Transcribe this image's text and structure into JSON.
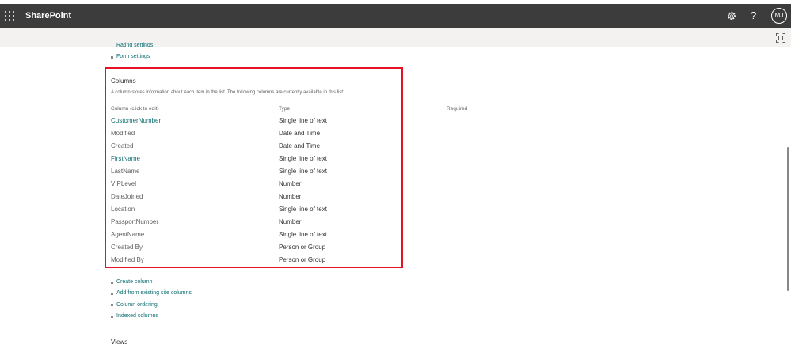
{
  "header": {
    "app_name": "SharePoint",
    "help_label": "?",
    "avatar_initials": "MJ"
  },
  "above": {
    "partial_link": "Rating settings",
    "form_settings": "Form settings"
  },
  "columns_section": {
    "title": "Columns",
    "description": "A column stores information about each item in the list. The following columns are currently available in this list:",
    "headers": {
      "name": "Column (click to edit)",
      "type": "Type",
      "required": "Required"
    },
    "rows": [
      {
        "name": "CustomerNumber",
        "type": "Single line of text",
        "link": true
      },
      {
        "name": "Modified",
        "type": "Date and Time",
        "link": false
      },
      {
        "name": "Created",
        "type": "Date and Time",
        "link": false
      },
      {
        "name": "FirstName",
        "type": "Single line of text",
        "link": true
      },
      {
        "name": "LastName",
        "type": "Single line of text",
        "link": false
      },
      {
        "name": "VIPLevel",
        "type": "Number",
        "link": false
      },
      {
        "name": "DateJoined",
        "type": "Number",
        "link": false
      },
      {
        "name": "Location",
        "type": "Single line of text",
        "link": false
      },
      {
        "name": "PassportNumber",
        "type": "Number",
        "link": false
      },
      {
        "name": "AgentName",
        "type": "Single line of text",
        "link": false
      },
      {
        "name": "Created By",
        "type": "Person or Group",
        "link": false
      },
      {
        "name": "Modified By",
        "type": "Person or Group",
        "link": false
      }
    ]
  },
  "actions": {
    "create_column": "Create column",
    "add_existing": "Add from existing site columns",
    "column_ordering": "Column ordering",
    "indexed_columns": "Indexed columns"
  },
  "views_section": {
    "title": "Views"
  },
  "colors": {
    "suite_bar": "#3c3c3c",
    "link": "#0f6e72",
    "highlight_box": "#e81123",
    "command_bar": "#f3f2f1"
  }
}
